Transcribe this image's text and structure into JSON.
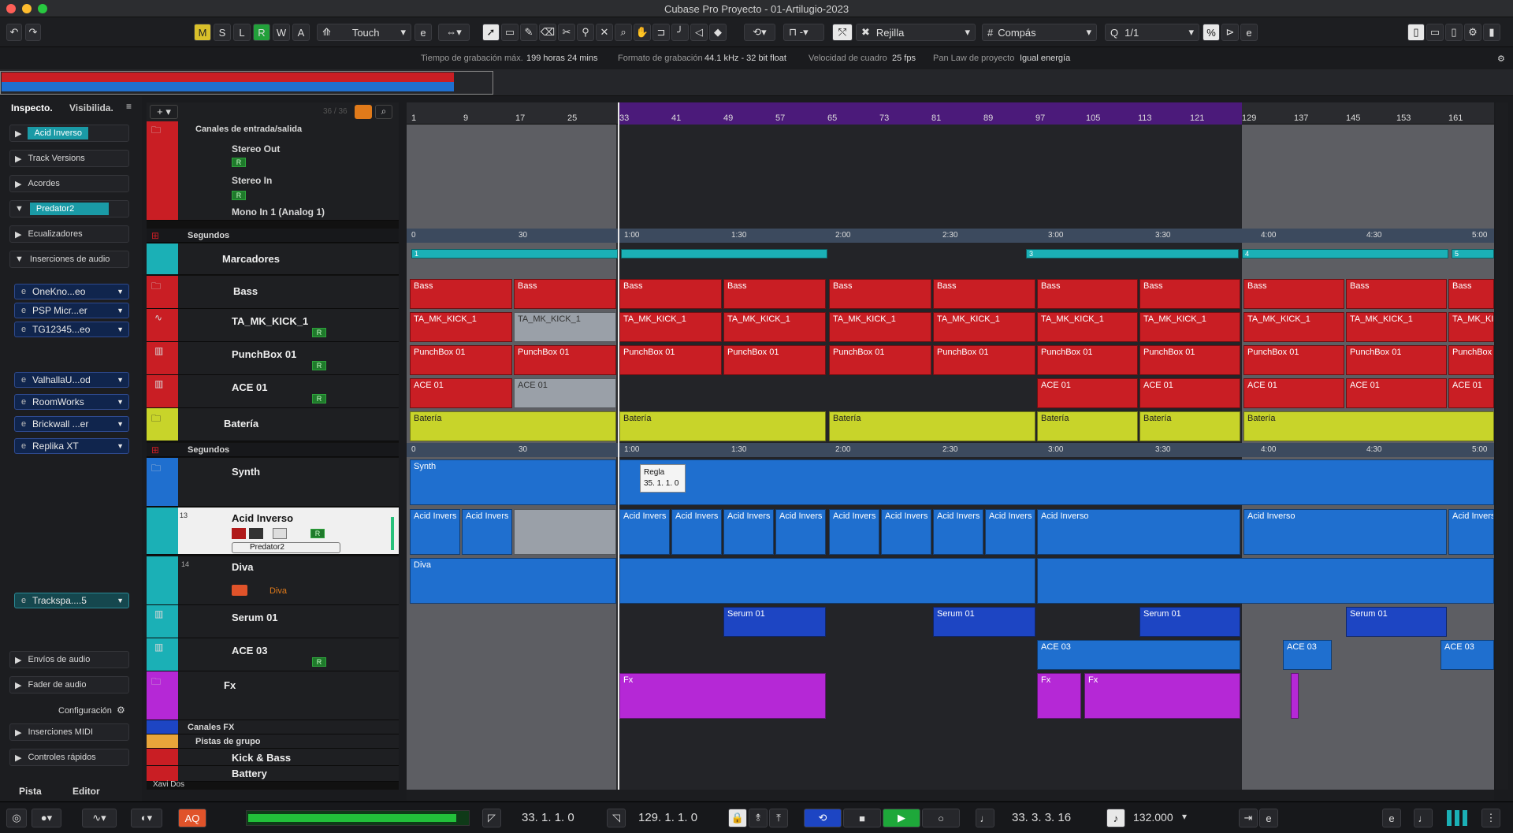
{
  "window": {
    "title": "Cubase Pro Proyecto - 01-Artilugio-2023"
  },
  "toolbar": {
    "msrwa": [
      "M",
      "S",
      "L",
      "R",
      "W",
      "A"
    ],
    "automation_mode": "Touch",
    "snap_type": "Rejilla",
    "grid": "Compás",
    "quantize": "1/1"
  },
  "infobar": {
    "rec_time_label": "Tiempo de grabación máx.",
    "rec_time_value": "199 horas 24 mins",
    "format_label": "Formato de grabación",
    "format_value": "44.1 kHz - 32 bit float",
    "fps_label": "Velocidad de cuadro",
    "fps_value": "25 fps",
    "panlaw_label": "Pan Law de proyecto",
    "panlaw_value": "Igual energía"
  },
  "inspector": {
    "tab_inspector": "Inspecto.",
    "tab_visibility": "Visibilida.",
    "track_name": "Acid Inverso",
    "track_versions": "Track Versions",
    "chords": "Acordes",
    "instrument": "Predator2",
    "equalizers": "Ecualizadores",
    "inserts": "Inserciones de audio",
    "plugins_a": [
      "OneKno...eo",
      "PSP Micr...er",
      "TG12345...eo"
    ],
    "plugins_b": [
      "ValhallaU...od",
      "RoomWorks",
      "Brickwall ...er",
      "Replika XT"
    ],
    "trackspacer": "Trackspa....5",
    "sends": "Envíos de audio",
    "fader": "Fader de audio",
    "config": "Configuración",
    "midi_inserts": "Inserciones MIDI",
    "quick_controls": "Controles rápidos",
    "tab_track": "Pista",
    "tab_editor": "Editor"
  },
  "tracklist": {
    "count": "36 / 36",
    "io_channels": "Canales de entrada/salida",
    "stereo_out": "Stereo Out",
    "stereo_in": "Stereo In",
    "mono_in": "Mono In 1 (Analog 1)",
    "seconds1": "Segundos",
    "markers": "Marcadores",
    "bass": "Bass",
    "kick": "TA_MK_KICK_1",
    "punchbox": "PunchBox 01",
    "ace01": "ACE 01",
    "bateria": "Batería",
    "seconds2": "Segundos",
    "synth": "Synth",
    "acid": "Acid Inverso",
    "acid_out": "Predator2",
    "diva": "Diva",
    "diva_sub": "Diva",
    "serum": "Serum 01",
    "ace03": "ACE 03",
    "fx": "Fx",
    "fx_channels": "Canales FX",
    "group_tracks": "Pistas de grupo",
    "kickbass": "Kick & Bass",
    "battery": "Battery",
    "user": "Xavi Dos",
    "r": "R"
  },
  "ruler": {
    "bars": [
      "1",
      "9",
      "17",
      "25",
      "33",
      "41",
      "49",
      "57",
      "65",
      "73",
      "81",
      "89",
      "97",
      "105",
      "113",
      "121",
      "129",
      "137",
      "145",
      "153",
      "161"
    ],
    "seconds": [
      "0",
      "30",
      "1:00",
      "1:30",
      "2:00",
      "2:30",
      "3:00",
      "3:30",
      "4:00",
      "4:30",
      "5:00"
    ]
  },
  "markers": [
    "1",
    "3",
    "4",
    "5"
  ],
  "tooltip": {
    "title": "Regla",
    "value": "35. 1. 1. 0"
  },
  "clips": {
    "bass": "Bass",
    "kick": "TA_MK_KICK_1",
    "kick_cut": "TA_MK_KICI",
    "punch": "PunchBox 01",
    "punch_cut": "PunchBox 0",
    "ace01": "ACE 01",
    "bateria": "Batería",
    "synth": "Synth",
    "acid": "Acid Inverso",
    "acid_cut": "Acid Invers",
    "acid_short": "Acid Invers",
    "diva": "Diva",
    "serum": "Serum 01",
    "ace03": "ACE 03",
    "fx": "Fx"
  },
  "transport": {
    "aq": "AQ",
    "left_locator": "33. 1. 1. 0",
    "right_locator": "129. 1. 1. 0",
    "position": "33. 3. 3. 16",
    "tempo": "132.000"
  }
}
